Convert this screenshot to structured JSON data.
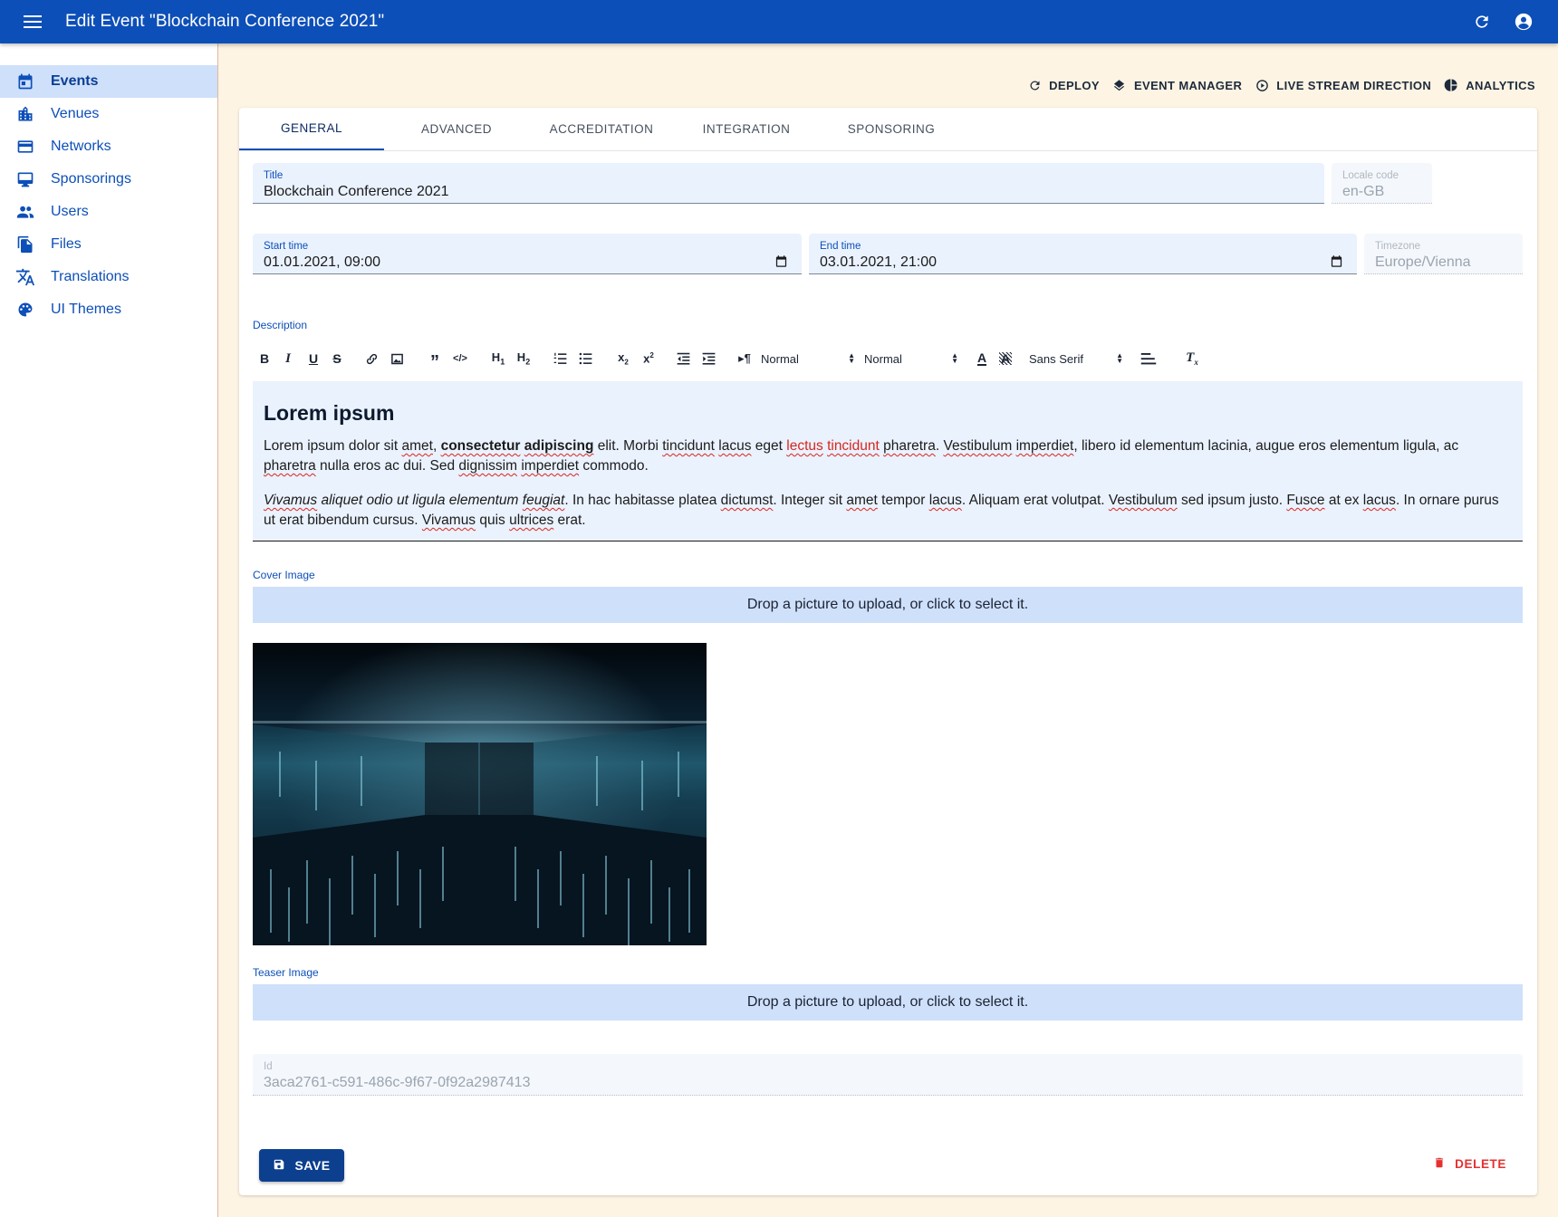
{
  "appbar": {
    "title": "Edit Event \"Blockchain Conference 2021\""
  },
  "sidebar": {
    "items": [
      {
        "label": "Events",
        "icon": "calendar-icon"
      },
      {
        "label": "Venues",
        "icon": "city-icon"
      },
      {
        "label": "Networks",
        "icon": "network-card-icon"
      },
      {
        "label": "Sponsorings",
        "icon": "monitor-icon"
      },
      {
        "label": "Users",
        "icon": "people-icon"
      },
      {
        "label": "Files",
        "icon": "files-icon"
      },
      {
        "label": "Translations",
        "icon": "translate-icon"
      },
      {
        "label": "UI Themes",
        "icon": "palette-icon"
      }
    ]
  },
  "actions": {
    "deploy": "DEPLOY",
    "event_manager": "EVENT MANAGER",
    "live_stream": "LIVE STREAM DIRECTION",
    "analytics": "ANALYTICS"
  },
  "tabs": [
    "GENERAL",
    "ADVANCED",
    "ACCREDITATION",
    "INTEGRATION",
    "SPONSORING"
  ],
  "form": {
    "title": {
      "label": "Title",
      "value": "Blockchain Conference 2021"
    },
    "locale": {
      "label": "Locale code",
      "value": "en-GB"
    },
    "start": {
      "label": "Start time",
      "value": "01.01.2021, 09:00"
    },
    "end": {
      "label": "End time",
      "value": "03.01.2021, 21:00"
    },
    "timezone": {
      "label": "Timezone",
      "value": "Europe/Vienna"
    },
    "description_label": "Description",
    "toolbar": {
      "size1": "Normal",
      "size2": "Normal",
      "font": "Sans Serif"
    },
    "description": {
      "heading": "Lorem ipsum"
    },
    "cover_label": "Cover Image",
    "teaser_label": "Teaser Image",
    "drop_text": "Drop a picture to upload, or click to select it.",
    "id": {
      "label": "Id",
      "value": "3aca2761-c591-486c-9f67-0f92a2987413"
    }
  },
  "buttons": {
    "save": "SAVE",
    "delete": "DELETE"
  },
  "colors": {
    "primary": "#0d4fb8",
    "background": "#fdf4e3",
    "danger": "#e53030",
    "field": "#eaf2fe"
  }
}
